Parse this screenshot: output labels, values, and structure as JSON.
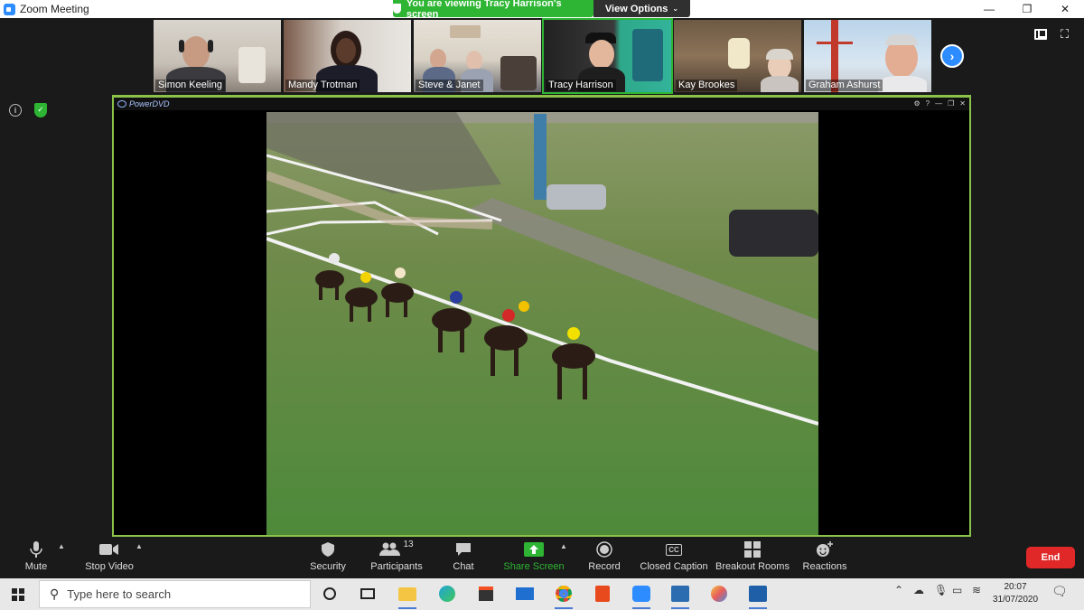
{
  "window": {
    "title": "Zoom Meeting",
    "controls": [
      "—",
      "❐",
      "✕"
    ]
  },
  "banner": {
    "viewing_text": "You are viewing Tracy Harrison's screen",
    "view_options_label": "View Options",
    "banner_color": "#2db533"
  },
  "participants_strip": [
    {
      "name": "Simon Keeling",
      "active": false
    },
    {
      "name": "Mandy Trotman",
      "active": false
    },
    {
      "name": "Steve & Janet",
      "active": false
    },
    {
      "name": "Tracy Harrison",
      "active": true
    },
    {
      "name": "Kay Brookes",
      "active": false
    },
    {
      "name": "Graham Ashurst",
      "active": false
    }
  ],
  "shared_app": {
    "title": "PowerDVD"
  },
  "toolbar": {
    "mute_label": "Mute",
    "stop_video_label": "Stop Video",
    "security_label": "Security",
    "participants_label": "Participants",
    "participants_count": "13",
    "chat_label": "Chat",
    "share_screen_label": "Share Screen",
    "record_label": "Record",
    "closed_caption_label": "Closed Caption",
    "cc_icon_text": "CC",
    "breakout_rooms_label": "Breakout Rooms",
    "reactions_label": "Reactions",
    "end_label": "End",
    "end_color": "#e02828"
  },
  "taskbar": {
    "search_placeholder": "Type here to search",
    "time": "20:07",
    "date": "31/07/2020",
    "apps": [
      "task-view",
      "file-explorer",
      "edge",
      "store",
      "mail",
      "chrome",
      "office",
      "zoom",
      "photos-app",
      "paint",
      "photos"
    ]
  }
}
